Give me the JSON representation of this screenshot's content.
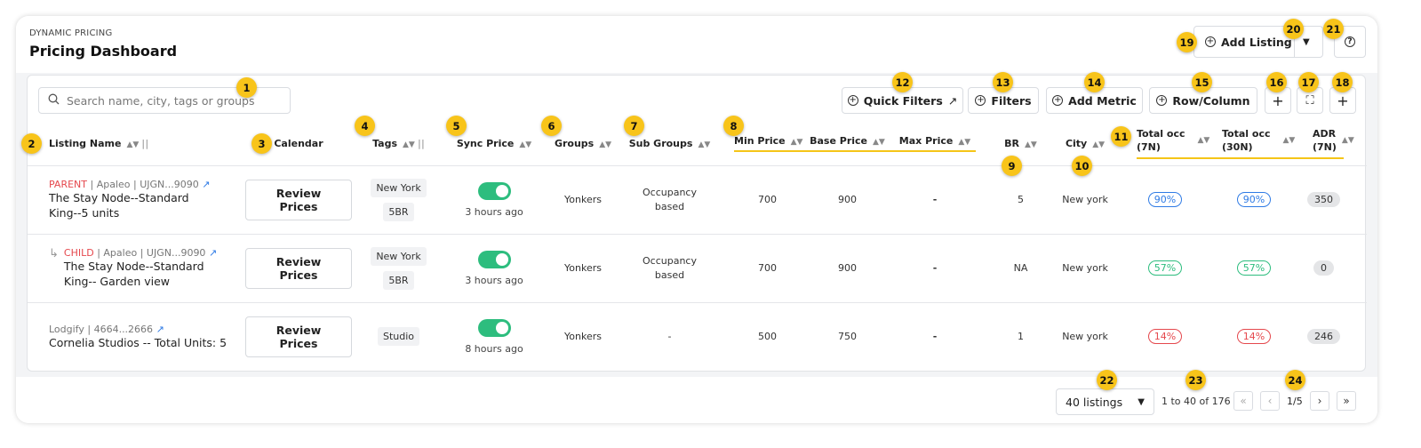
{
  "header": {
    "eyebrow": "DYNAMIC PRICING",
    "title": "Pricing Dashboard",
    "add_listing": "Add Listing",
    "help_icon": "question-circle-icon"
  },
  "toolbar": {
    "search_placeholder": "Search name, city, tags or groups",
    "quick_filters": "Quick Filters",
    "filters": "Filters",
    "add_metric": "Add Metric",
    "row_column": "Row/Column"
  },
  "columns": {
    "listing_name": "Listing Name",
    "calendar": "Calendar",
    "tags": "Tags",
    "sync_price": "Sync Price",
    "groups": "Groups",
    "sub_groups": "Sub Groups",
    "min_price": "Min Price",
    "base_price": "Base Price",
    "max_price": "Max Price",
    "br": "BR",
    "city": "City",
    "occ7_a": "Total occ",
    "occ7_b": "(7N)",
    "occ30_a": "Total occ",
    "occ30_b": "(30N)",
    "adr_a": "ADR",
    "adr_b": "(7N)"
  },
  "rows": [
    {
      "type": "PARENT",
      "meta": " | Apaleo | UJGN...9090",
      "name1": "The Stay Node--Standard",
      "name2": "King--5 units",
      "review": "Review Prices",
      "tags": [
        "New York",
        "5BR"
      ],
      "sync_on": true,
      "synced": "3 hours ago",
      "group": "Yonkers",
      "sub1": "Occupancy",
      "sub2": "based",
      "min": "700",
      "base": "900",
      "max": "-",
      "br": "5",
      "city": "New york",
      "occ7": "90%",
      "occ30": "90%",
      "occ_color": "#2f7be5",
      "adr": "350"
    },
    {
      "type": "CHILD",
      "meta": " | Apaleo | UJGN...9090",
      "name1": "The Stay Node--Standard",
      "name2": "King-- Garden view",
      "review": "Review Prices",
      "tags": [
        "New York",
        "5BR"
      ],
      "sync_on": true,
      "synced": "3 hours ago",
      "group": "Yonkers",
      "sub1": "Occupancy",
      "sub2": "based",
      "min": "700",
      "base": "900",
      "max": "-",
      "br": "NA",
      "city": "New york",
      "occ7": "57%",
      "occ30": "57%",
      "occ_color": "#2dbd7e",
      "adr": "0"
    },
    {
      "type": "",
      "meta": "Lodgify | 4664...2666",
      "name1": "Cornelia Studios -- Total Units: 5",
      "name2": "",
      "review": "Review Prices",
      "tags": [
        "Studio"
      ],
      "sync_on": true,
      "synced": "8 hours ago",
      "group": "Yonkers",
      "sub1": "-",
      "sub2": "",
      "min": "500",
      "base": "750",
      "max": "-",
      "br": "1",
      "city": "New york",
      "occ7": "14%",
      "occ30": "14%",
      "occ_color": "#e5484d",
      "adr": "246"
    }
  ],
  "footer": {
    "page_size": "40 listings",
    "range": "1 to 40 of 176",
    "page": "1/5"
  },
  "colors": {
    "accent": "#f5c518",
    "toggle": "#2dbd7e",
    "parent": "#e5484d",
    "link": "#2f7be5"
  },
  "annotations": [
    "1",
    "2",
    "3",
    "4",
    "5",
    "6",
    "7",
    "8",
    "9",
    "10",
    "11",
    "12",
    "13",
    "14",
    "15",
    "16",
    "17",
    "18",
    "19",
    "20",
    "21",
    "22",
    "23",
    "24"
  ]
}
